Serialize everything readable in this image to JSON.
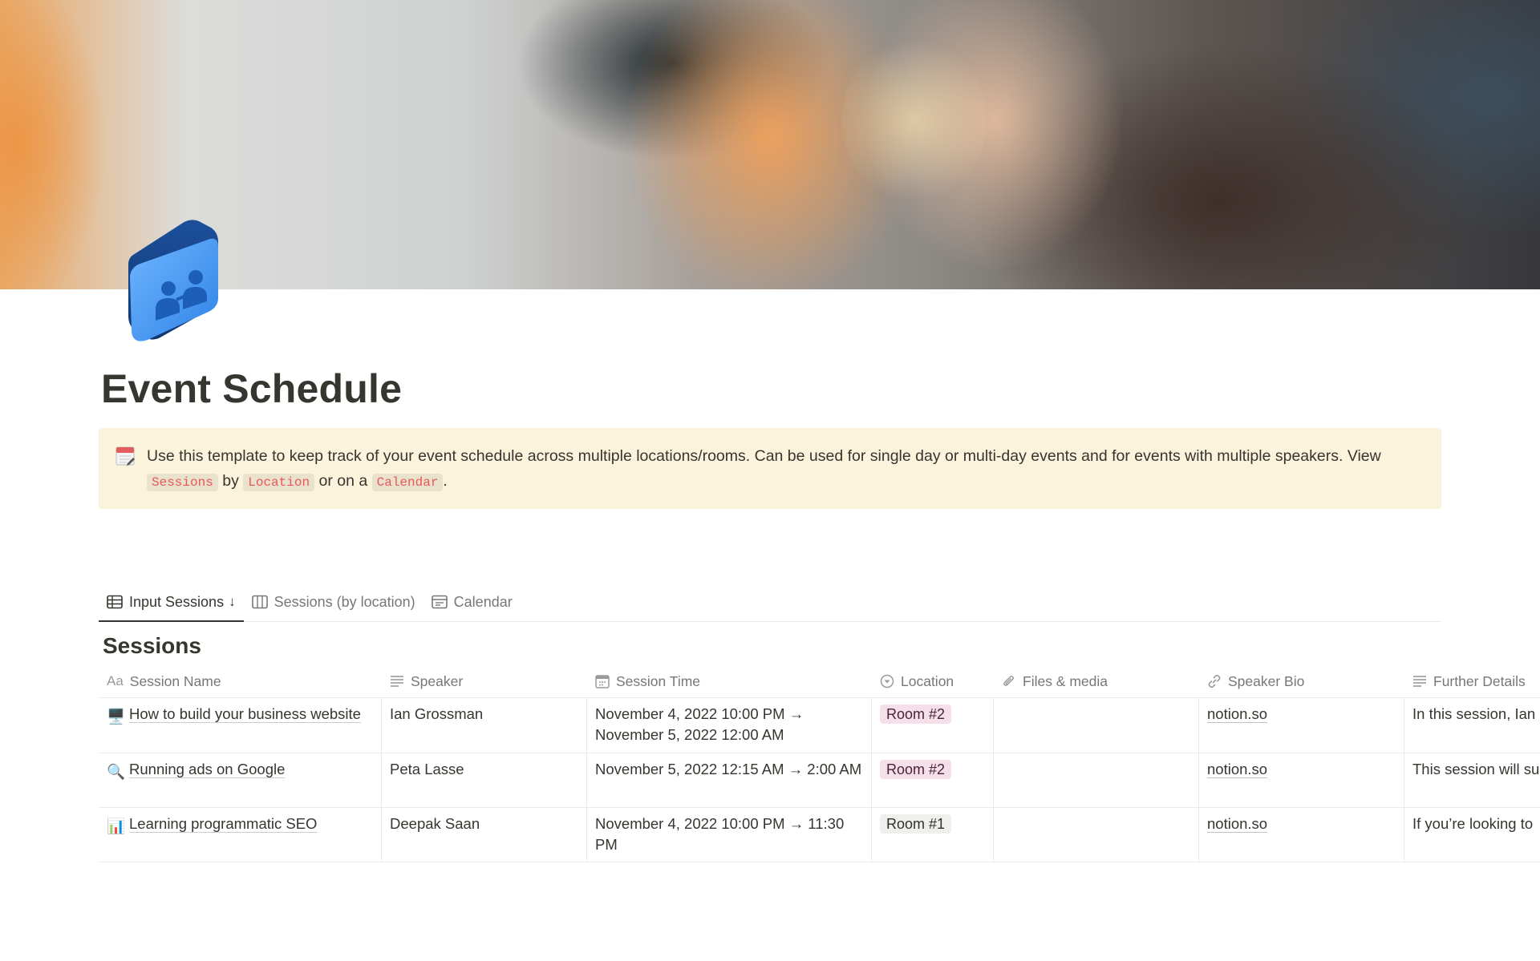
{
  "page": {
    "title": "Event Schedule",
    "icon": "people-folder-icon",
    "cover": "photo-two-women-laughing"
  },
  "callout": {
    "icon": "calendar-notepad-icon",
    "text_before": "Use this template to keep track of your event schedule across multiple locations/rooms. Can be used for single day or multi-day events and for events with multiple speakers. View ",
    "code1": "Sessions",
    "text_mid1": " by ",
    "code2": "Location",
    "text_mid2": " or on a ",
    "code3": "Calendar",
    "text_after": "."
  },
  "tabs": [
    {
      "label": "Input Sessions",
      "icon": "table-icon",
      "active": true,
      "suffix": "↓"
    },
    {
      "label": "Sessions (by location)",
      "icon": "board-icon",
      "active": false
    },
    {
      "label": "Calendar",
      "icon": "calendar-icon",
      "active": false
    }
  ],
  "database": {
    "title": "Sessions",
    "columns": [
      {
        "label": "Session Name",
        "icon": "title-aa-icon"
      },
      {
        "label": "Speaker",
        "icon": "text-lines-icon"
      },
      {
        "label": "Session Time",
        "icon": "date-icon"
      },
      {
        "label": "Location",
        "icon": "select-icon"
      },
      {
        "label": "Files & media",
        "icon": "paperclip-icon"
      },
      {
        "label": "Speaker Bio",
        "icon": "link-icon"
      },
      {
        "label": "Further Details",
        "icon": "text-lines-icon"
      }
    ],
    "rows": [
      {
        "emoji": "🖥️",
        "name": "How to build your business website",
        "speaker": "Ian Grossman",
        "time": "November 4, 2022 10:00 PM → November 5, 2022 12:00 AM",
        "location": "Room #2",
        "files": "",
        "bio": "notion.so",
        "details": "In this session, Ian"
      },
      {
        "emoji": "🔍",
        "name": "Running ads on Google",
        "speaker": "Peta Lasse",
        "time": "November 5, 2022 12:15 AM → 2:00 AM",
        "location": "Room #2",
        "files": "",
        "bio": "notion.so",
        "details": "This session will su"
      },
      {
        "emoji": "📊",
        "name": "Learning programmatic SEO",
        "speaker": "Deepak Saan",
        "time": "November 4, 2022 10:00 PM → 11:30 PM",
        "location": "Room #1",
        "files": "",
        "bio": "notion.so",
        "details": "If you’re looking to"
      }
    ]
  },
  "colors": {
    "callout_bg": "#fbf3db",
    "code_red": "#eb5757",
    "room2_tag_bg": "#f5e0e9",
    "room1_tag_bg": "#efefed"
  }
}
